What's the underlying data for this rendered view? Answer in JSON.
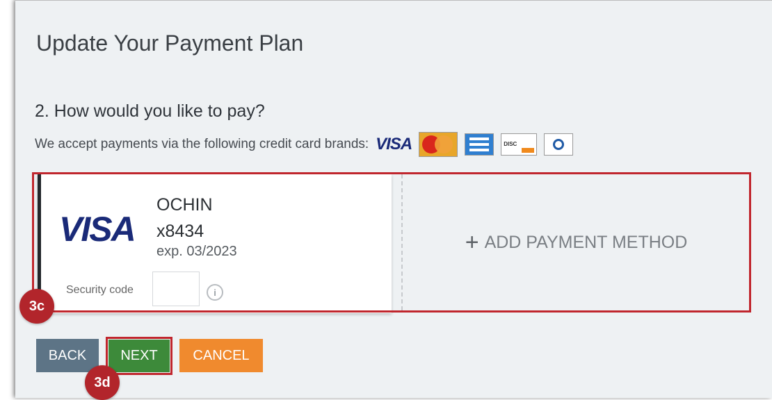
{
  "page": {
    "title": "Update Your Payment Plan"
  },
  "payment_section": {
    "heading": "2. How would you like to pay?",
    "accept_text": "We accept payments via the following credit card brands:",
    "brands": [
      {
        "name": "VISA",
        "icon": "visa-logo"
      },
      {
        "name": "MasterCard",
        "icon": "mastercard-icon"
      },
      {
        "name": "American Express",
        "icon": "amex-icon"
      },
      {
        "name": "Discover",
        "icon": "discover-icon"
      },
      {
        "name": "Diners Club",
        "icon": "diners-club-icon"
      }
    ],
    "visa_text": "VISA"
  },
  "saved_card": {
    "brand": "VISA",
    "holder": "OCHIN",
    "last4": "x8434",
    "expiry": "exp. 03/2023",
    "security_label": "Security code",
    "security_value": ""
  },
  "add_method": {
    "label": "ADD PAYMENT METHOD",
    "icon": "plus-icon"
  },
  "buttons": {
    "back": "BACK",
    "next": "NEXT",
    "cancel": "CANCEL"
  },
  "annotations": {
    "step_3c": "3c",
    "step_3d": "3d"
  },
  "colors": {
    "highlight": "#c0262d",
    "back": "#5d7486",
    "next": "#3d8a3a",
    "cancel": "#f08a2e",
    "badge": "#b2252b"
  }
}
